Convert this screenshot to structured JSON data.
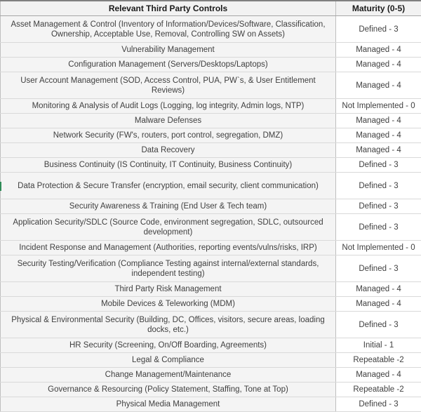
{
  "table": {
    "headers": {
      "control": "Relevant Third Party Controls",
      "maturity": "Maturity (0-5)"
    },
    "rows": [
      {
        "control": "Asset Management & Control (Inventory of Information/Devices/Software, Classification, Ownership, Acceptable Use, Removal, Controlling SW on Assets)",
        "maturity": "Defined - 3",
        "lines": 2
      },
      {
        "control": "Vulnerability Management",
        "maturity": "Managed - 4",
        "lines": 1
      },
      {
        "control": "Configuration Management (Servers/Desktops/Laptops)",
        "maturity": "Managed - 4",
        "lines": 1
      },
      {
        "control": "User Account Management (SOD, Access Control, PUA, PW`s, & User Entitlement Reviews)",
        "maturity": "Managed - 4",
        "lines": 2
      },
      {
        "control": "Monitoring & Analysis of Audit Logs (Logging, log integrity, Admin logs, NTP)",
        "maturity": "Not Implemented - 0",
        "lines": 1
      },
      {
        "control": "Malware Defenses",
        "maturity": "Managed - 4",
        "lines": 1
      },
      {
        "control": "Network Security (FW's, routers, port control, segregation, DMZ)",
        "maturity": "Managed - 4",
        "lines": 1
      },
      {
        "control": "Data Recovery",
        "maturity": "Managed - 4",
        "lines": 1
      },
      {
        "control": "Business Continuity (IS Continuity, IT Continuity, Business Continuity)",
        "maturity": "Defined - 3",
        "lines": 1
      },
      {
        "control": "Data Protection & Secure Transfer (encryption, email security, client communication)",
        "maturity": "Defined - 3",
        "lines": 2
      },
      {
        "control": "Security Awareness & Training (End User & Tech team)",
        "maturity": "Defined - 3",
        "lines": 1
      },
      {
        "control": "Application Security/SDLC (Source Code, environment segregation, SDLC, outsourced development)",
        "maturity": "Defined - 3",
        "lines": 2
      },
      {
        "control": "Incident Response and Management (Authorities, reporting events/vulns/risks, IRP)",
        "maturity": "Not Implemented - 0",
        "lines": 1
      },
      {
        "control": "Security Testing/Verification (Compliance Testing against internal/external standards, independent testing)",
        "maturity": "Defined - 3",
        "lines": 2
      },
      {
        "control": "Third Party Risk Management",
        "maturity": "Managed - 4",
        "lines": 1
      },
      {
        "control": "Mobile Devices & Teleworking (MDM)",
        "maturity": "Managed - 4",
        "lines": 1
      },
      {
        "control": "Physical & Environmental Security (Building, DC, Offices, visitors, secure areas, loading docks, etc.)",
        "maturity": "Defined - 3",
        "lines": 2
      },
      {
        "control": "HR Security (Screening, On/Off Boarding, Agreements)",
        "maturity": "Initial - 1",
        "lines": 1
      },
      {
        "control": "Legal & Compliance",
        "maturity": "Repeatable -2",
        "lines": 1
      },
      {
        "control": "Change Management/Maintenance",
        "maturity": "Managed - 4",
        "lines": 1
      },
      {
        "control": "Governance & Resourcing (Policy Statement, Staffing, Tone at Top)",
        "maturity": "Repeatable -2",
        "lines": 1
      },
      {
        "control": "Physical Media Management",
        "maturity": "Defined - 3",
        "lines": 1
      }
    ]
  },
  "colors": {
    "header_background": "#f2f2f2",
    "control_cell_background": "#f4f4f4",
    "maturity_cell_background": "#ffffff",
    "grid_line": "#d9d9d9",
    "text": "#404040",
    "edge_marker": "#2e8b57"
  }
}
